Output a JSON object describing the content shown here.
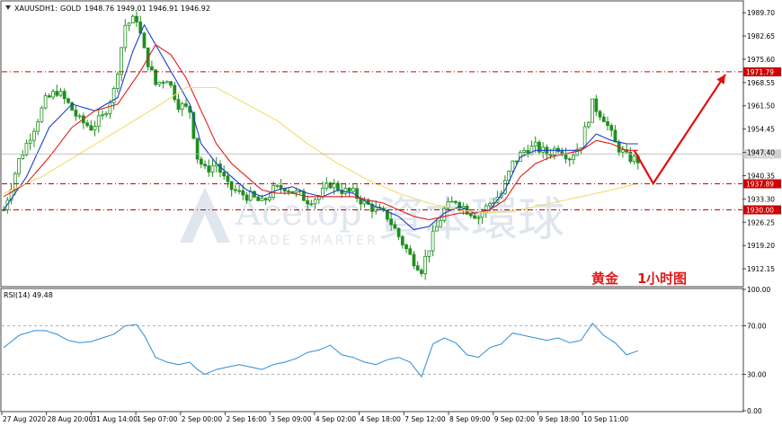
{
  "header": {
    "symbol": "XAUUSD",
    "timeframe": "H1:",
    "name": "GOLD",
    "ohlc": "1948.76 1949.01 1946.91 1946.92"
  },
  "watermark": {
    "brand": "Acetop",
    "tagline": "TRADE SMARTER",
    "chinese": "資本環球"
  },
  "annotation": {
    "text": "黄金",
    "number": "1",
    "unit": "小时图",
    "color": "#e0191b"
  },
  "colors": {
    "candle": "#1f8f1f",
    "ma_fast": "#1a3fd0",
    "ma_mid": "#e01e1e",
    "ma_slow": "#f2dc6e",
    "levels": "#cc0000",
    "rsi": "#2a8ed8",
    "arrow": "#e01010",
    "grid": "#d8d8d8"
  },
  "chart_data": [
    {
      "type": "candlestick",
      "y_ticks": [
        "1989.70",
        "1982.65",
        "1975.60",
        "1968.55",
        "1961.50",
        "1954.45",
        "1947.40",
        "1940.35",
        "1933.30",
        "1926.25",
        "1919.20",
        "1912.15"
      ],
      "ylim": [
        1907,
        1993
      ],
      "x_labels": [
        "27 Aug 2020",
        "28 Aug 20:00",
        "31 Aug 14:00",
        "1 Sep 07:00",
        "2 Sep 00:00",
        "2 Sep 16:00",
        "3 Sep 09:00",
        "4 Sep 02:00",
        "4 Sep 18:00",
        "7 Sep 12:00",
        "8 Sep 09:00",
        "9 Sep 02:00",
        "9 Sep 18:00",
        "10 Sep 11:00"
      ],
      "price_tags": [
        {
          "label": "1971.79",
          "value": 1971.79,
          "style": "level"
        },
        {
          "label": "1946.92",
          "value": 1946.92,
          "style": "current"
        },
        {
          "label": "1937.89",
          "value": 1937.89,
          "style": "level"
        },
        {
          "label": "1930.00",
          "value": 1930.0,
          "style": "level"
        }
      ],
      "close_path": [
        [
          0,
          1930
        ],
        [
          4,
          1945
        ],
        [
          8,
          1955
        ],
        [
          11,
          1963
        ],
        [
          14,
          1966
        ],
        [
          17,
          1962
        ],
        [
          20,
          1957
        ],
        [
          23,
          1955
        ],
        [
          26,
          1958
        ],
        [
          29,
          1966
        ],
        [
          32,
          1986
        ],
        [
          35,
          1988
        ],
        [
          37,
          1978
        ],
        [
          40,
          1968
        ],
        [
          43,
          1970
        ],
        [
          46,
          1962
        ],
        [
          49,
          1960
        ],
        [
          51,
          1946
        ],
        [
          53,
          1942
        ],
        [
          56,
          1944
        ],
        [
          59,
          1937
        ],
        [
          62,
          1935
        ],
        [
          65,
          1934
        ],
        [
          68,
          1932
        ],
        [
          71,
          1936
        ],
        [
          74,
          1937
        ],
        [
          77,
          1935
        ],
        [
          80,
          1933
        ],
        [
          83,
          1934
        ],
        [
          86,
          1938
        ],
        [
          89,
          1936
        ],
        [
          92,
          1935
        ],
        [
          95,
          1932
        ],
        [
          98,
          1930
        ],
        [
          101,
          1928
        ],
        [
          104,
          1922
        ],
        [
          107,
          1916
        ],
        [
          110,
          1912
        ],
        [
          113,
          1922
        ],
        [
          116,
          1930
        ],
        [
          119,
          1933
        ],
        [
          122,
          1930
        ],
        [
          125,
          1928
        ],
        [
          128,
          1932
        ],
        [
          131,
          1935
        ],
        [
          134,
          1944
        ],
        [
          137,
          1948
        ],
        [
          140,
          1949
        ],
        [
          143,
          1947
        ],
        [
          146,
          1949
        ],
        [
          149,
          1946
        ],
        [
          152,
          1950
        ],
        [
          155,
          1962
        ],
        [
          158,
          1958
        ],
        [
          161,
          1950
        ],
        [
          164,
          1946
        ],
        [
          167,
          1945
        ]
      ],
      "series": [
        {
          "name": "MA fast",
          "path": [
            [
              0,
              1930
            ],
            [
              6,
              1940
            ],
            [
              12,
              1955
            ],
            [
              18,
              1962
            ],
            [
              24,
              1960
            ],
            [
              30,
              1964
            ],
            [
              34,
              1978
            ],
            [
              37,
              1986
            ],
            [
              41,
              1978
            ],
            [
              45,
              1970
            ],
            [
              49,
              1962
            ],
            [
              52,
              1950
            ],
            [
              56,
              1944
            ],
            [
              60,
              1940
            ],
            [
              64,
              1936
            ],
            [
              68,
              1934
            ],
            [
              72,
              1936
            ],
            [
              76,
              1937
            ],
            [
              80,
              1935
            ],
            [
              84,
              1934
            ],
            [
              88,
              1936
            ],
            [
              92,
              1935
            ],
            [
              96,
              1932
            ],
            [
              100,
              1930
            ],
            [
              104,
              1928
            ],
            [
              108,
              1924
            ],
            [
              112,
              1925
            ],
            [
              116,
              1929
            ],
            [
              120,
              1931
            ],
            [
              124,
              1929
            ],
            [
              128,
              1930
            ],
            [
              132,
              1936
            ],
            [
              136,
              1946
            ],
            [
              140,
              1948
            ],
            [
              144,
              1948
            ],
            [
              148,
              1948
            ],
            [
              152,
              1948
            ],
            [
              156,
              1953
            ],
            [
              160,
              1951
            ],
            [
              164,
              1950
            ],
            [
              167,
              1950
            ]
          ]
        },
        {
          "name": "MA mid",
          "path": [
            [
              0,
              1934
            ],
            [
              6,
              1938
            ],
            [
              12,
              1946
            ],
            [
              18,
              1955
            ],
            [
              24,
              1960
            ],
            [
              30,
              1962
            ],
            [
              36,
              1972
            ],
            [
              40,
              1980
            ],
            [
              44,
              1977
            ],
            [
              48,
              1970
            ],
            [
              52,
              1960
            ],
            [
              56,
              1950
            ],
            [
              60,
              1944
            ],
            [
              64,
              1940
            ],
            [
              68,
              1936
            ],
            [
              72,
              1935
            ],
            [
              76,
              1935
            ],
            [
              80,
              1934
            ],
            [
              84,
              1934
            ],
            [
              88,
              1934
            ],
            [
              92,
              1934
            ],
            [
              96,
              1933
            ],
            [
              100,
              1932
            ],
            [
              104,
              1930
            ],
            [
              108,
              1928
            ],
            [
              112,
              1927
            ],
            [
              116,
              1928
            ],
            [
              120,
              1929
            ],
            [
              124,
              1929
            ],
            [
              128,
              1930
            ],
            [
              132,
              1933
            ],
            [
              136,
              1940
            ],
            [
              140,
              1944
            ],
            [
              144,
              1946
            ],
            [
              148,
              1947
            ],
            [
              152,
              1948
            ],
            [
              156,
              1951
            ],
            [
              160,
              1950
            ],
            [
              164,
              1948
            ],
            [
              167,
              1948
            ]
          ]
        },
        {
          "name": "MA slow",
          "path": [
            [
              0,
              1935
            ],
            [
              10,
              1940
            ],
            [
              20,
              1947
            ],
            [
              30,
              1954
            ],
            [
              40,
              1961
            ],
            [
              48,
              1967
            ],
            [
              56,
              1967
            ],
            [
              64,
              1962
            ],
            [
              72,
              1957
            ],
            [
              80,
              1950
            ],
            [
              88,
              1944
            ],
            [
              96,
              1939
            ],
            [
              104,
              1935
            ],
            [
              112,
              1932
            ],
            [
              120,
              1930
            ],
            [
              128,
              1929
            ],
            [
              136,
              1930
            ],
            [
              144,
              1932
            ],
            [
              152,
              1934
            ],
            [
              160,
              1936
            ],
            [
              167,
              1938
            ]
          ]
        }
      ],
      "arrow_path": [
        [
          166,
          1948
        ],
        [
          171,
          1938
        ],
        [
          190,
          1971
        ]
      ]
    },
    {
      "type": "line",
      "title": "RSI(14) 49.48",
      "y_ticks": [
        "100.00",
        "70.00",
        "30.00",
        "0.00"
      ],
      "ylim": [
        0,
        100
      ],
      "levels": [
        70,
        30
      ],
      "series": [
        {
          "name": "RSI(14)",
          "path": [
            [
              0,
              52
            ],
            [
              4,
              62
            ],
            [
              8,
              66
            ],
            [
              11,
              66
            ],
            [
              14,
              63
            ],
            [
              17,
              58
            ],
            [
              20,
              56
            ],
            [
              23,
              57
            ],
            [
              26,
              60
            ],
            [
              29,
              63
            ],
            [
              32,
              70
            ],
            [
              35,
              71
            ],
            [
              37,
              62
            ],
            [
              40,
              44
            ],
            [
              43,
              40
            ],
            [
              46,
              38
            ],
            [
              49,
              40
            ],
            [
              51,
              34
            ],
            [
              53,
              30
            ],
            [
              56,
              34
            ],
            [
              59,
              36
            ],
            [
              62,
              38
            ],
            [
              65,
              36
            ],
            [
              68,
              34
            ],
            [
              71,
              38
            ],
            [
              74,
              40
            ],
            [
              77,
              43
            ],
            [
              80,
              48
            ],
            [
              83,
              50
            ],
            [
              86,
              54
            ],
            [
              89,
              46
            ],
            [
              92,
              44
            ],
            [
              95,
              40
            ],
            [
              98,
              38
            ],
            [
              101,
              42
            ],
            [
              104,
              44
            ],
            [
              107,
              40
            ],
            [
              110,
              28
            ],
            [
              113,
              55
            ],
            [
              116,
              60
            ],
            [
              119,
              56
            ],
            [
              122,
              46
            ],
            [
              125,
              44
            ],
            [
              128,
              52
            ],
            [
              131,
              55
            ],
            [
              134,
              64
            ],
            [
              137,
              62
            ],
            [
              140,
              60
            ],
            [
              143,
              58
            ],
            [
              146,
              60
            ],
            [
              149,
              56
            ],
            [
              152,
              58
            ],
            [
              155,
              72
            ],
            [
              158,
              62
            ],
            [
              161,
              56
            ],
            [
              164,
              46
            ],
            [
              167,
              49.48
            ]
          ]
        }
      ]
    }
  ]
}
